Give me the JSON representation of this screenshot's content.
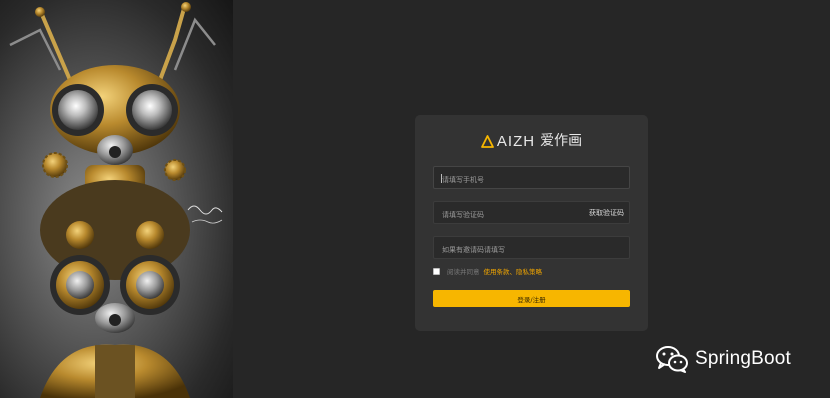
{
  "logo": {
    "text": "AIZH",
    "cn": "爱作画"
  },
  "form": {
    "phone_placeholder": "请填写手机号",
    "code_placeholder": "请填写验证码",
    "code_button": "获取验证码",
    "invite_placeholder": "如果有邀请码请填写",
    "agree_text": "阅读并同意",
    "agree_links": "使用条款、隐私策略",
    "submit_label": "登录/注册",
    "agree_checked": false
  },
  "watermark": {
    "text": "SpringBoot"
  },
  "colors": {
    "accent": "#f7b600",
    "link": "#f0a500",
    "background": "#262626",
    "card": "#333333"
  },
  "icons": [
    "steampunk-robot-artwork",
    "logo-triangle-icon",
    "wechat-icon"
  ]
}
